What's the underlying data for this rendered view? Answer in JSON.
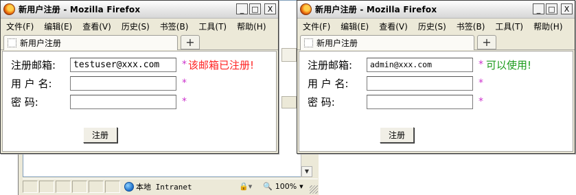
{
  "background_window": {
    "status_zone": "本地 Intranet",
    "zoom": "100%"
  },
  "windows": [
    {
      "title": "新用户注册 - Mozilla Firefox",
      "window_buttons": [
        "_",
        "□",
        "X"
      ],
      "menus": [
        "文件(F)",
        "编辑(E)",
        "查看(V)",
        "历史(S)",
        "书签(B)",
        "工具(T)",
        "帮助(H)"
      ],
      "tab_label": "新用户注册",
      "new_tab": "+",
      "form": {
        "email_label": "注册邮箱:",
        "email_value": "testuser@xxx.com",
        "email_message": "该邮箱已注册!",
        "username_label": "用 户 名:",
        "username_value": "",
        "password_label": "密    码:",
        "password_value": "",
        "required_mark": "*",
        "submit_label": "注册"
      }
    },
    {
      "title": "新用户注册 - Mozilla Firefox",
      "window_buttons": [
        "_",
        "□",
        "X"
      ],
      "menus": [
        "文件(F)",
        "编辑(E)",
        "查看(V)",
        "历史(S)",
        "书签(B)",
        "工具(T)",
        "帮助(H)"
      ],
      "tab_label": "新用户注册",
      "new_tab": "+",
      "form": {
        "email_label": "注册邮箱:",
        "email_value": "admin@xxx.com",
        "email_message": "可以使用!",
        "username_label": "用 户 名:",
        "username_value": "",
        "password_label": "密    码:",
        "password_value": "",
        "required_mark": "*",
        "submit_label": "注册"
      }
    }
  ],
  "colors": {
    "error": "#ff2222",
    "success": "#1a9a1a",
    "required_star": "#cc33cc"
  }
}
